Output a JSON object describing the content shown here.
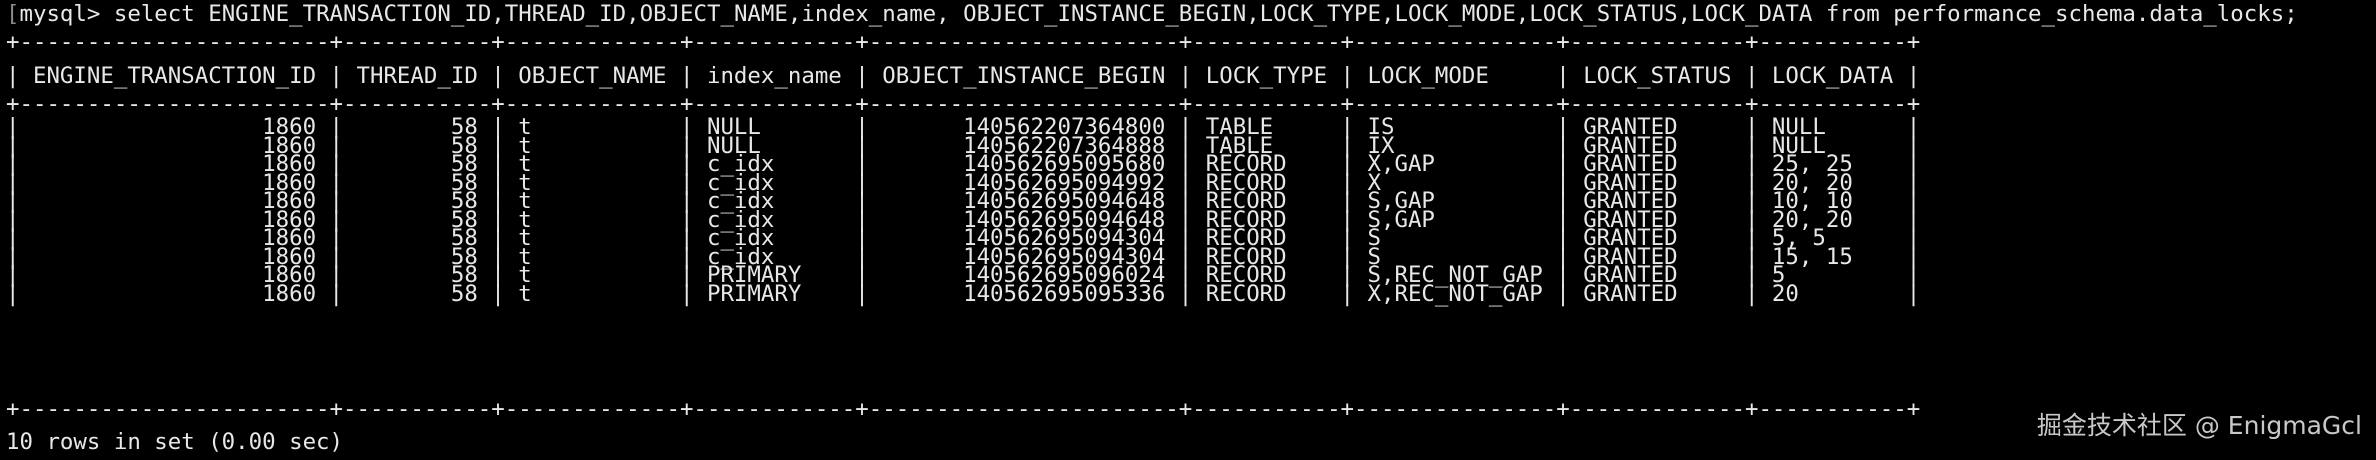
{
  "terminal": {
    "prompt": "mysql> ",
    "query": "select ENGINE_TRANSACTION_ID,THREAD_ID,OBJECT_NAME,index_name, OBJECT_INSTANCE_BEGIN,LOCK_TYPE,LOCK_MODE,LOCK_STATUS,LOCK_DATA from performance_schema.data_locks;",
    "columns": [
      "ENGINE_TRANSACTION_ID",
      "THREAD_ID",
      "OBJECT_NAME",
      "index_name",
      "OBJECT_INSTANCE_BEGIN",
      "LOCK_TYPE",
      "LOCK_MODE",
      "LOCK_STATUS",
      "LOCK_DATA"
    ],
    "rows": [
      [
        "1860",
        "58",
        "t",
        "NULL",
        "140562207364800",
        "TABLE",
        "IS",
        "GRANTED",
        "NULL"
      ],
      [
        "1860",
        "58",
        "t",
        "NULL",
        "140562207364888",
        "TABLE",
        "IX",
        "GRANTED",
        "NULL"
      ],
      [
        "1860",
        "58",
        "t",
        "c_idx",
        "140562695095680",
        "RECORD",
        "X,GAP",
        "GRANTED",
        "25, 25"
      ],
      [
        "1860",
        "58",
        "t",
        "c_idx",
        "140562695094992",
        "RECORD",
        "X",
        "GRANTED",
        "20, 20"
      ],
      [
        "1860",
        "58",
        "t",
        "c_idx",
        "140562695094648",
        "RECORD",
        "S,GAP",
        "GRANTED",
        "10, 10"
      ],
      [
        "1860",
        "58",
        "t",
        "c_idx",
        "140562695094648",
        "RECORD",
        "S,GAP",
        "GRANTED",
        "20, 20"
      ],
      [
        "1860",
        "58",
        "t",
        "c_idx",
        "140562695094304",
        "RECORD",
        "S",
        "GRANTED",
        "5, 5"
      ],
      [
        "1860",
        "58",
        "t",
        "c_idx",
        "140562695094304",
        "RECORD",
        "S",
        "GRANTED",
        "15, 15"
      ],
      [
        "1860",
        "58",
        "t",
        "PRIMARY",
        "140562695096024",
        "RECORD",
        "S,REC_NOT_GAP",
        "GRANTED",
        "5"
      ],
      [
        "1860",
        "58",
        "t",
        "PRIMARY",
        "140562695095336",
        "RECORD",
        "X,REC_NOT_GAP",
        "GRANTED",
        "20"
      ]
    ],
    "footer": "10 rows in set (0.00 sec)"
  },
  "watermark": "掘金技术社区 @ EnigmaGcl",
  "colors": {
    "background": "#000000",
    "text": "#e8e8e8"
  }
}
